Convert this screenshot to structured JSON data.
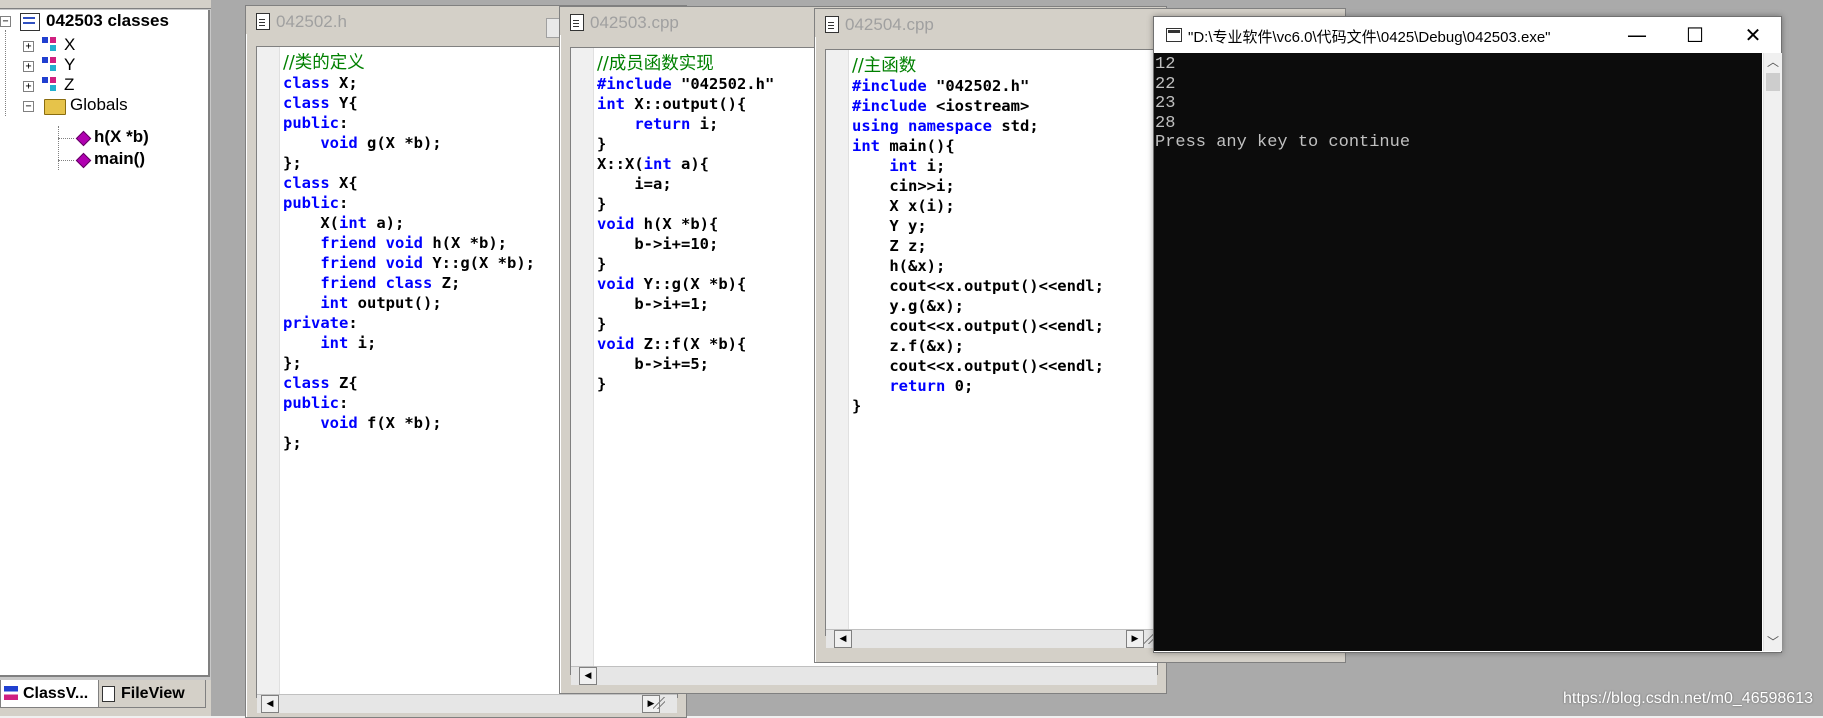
{
  "class_view": {
    "root_label": "042503 classes",
    "items": [
      {
        "label": "X",
        "type": "class"
      },
      {
        "label": "Y",
        "type": "class"
      },
      {
        "label": "Z",
        "type": "class"
      },
      {
        "label": "Globals",
        "type": "folder"
      }
    ],
    "globals_children": [
      "h(X *b)",
      "main()"
    ],
    "tabs": [
      {
        "label": "ClassV...",
        "active": true
      },
      {
        "label": "FileView",
        "active": false
      }
    ]
  },
  "windows": {
    "h": {
      "title": "042502.h",
      "lines": [
        [
          {
            "t": "//类的定义",
            "c": "cm"
          }
        ],
        [
          {
            "t": "class",
            "c": "kw"
          },
          {
            "t": " X;"
          }
        ],
        [
          {
            "t": "class",
            "c": "kw"
          },
          {
            "t": " Y{"
          }
        ],
        [
          {
            "t": "public",
            "c": "kw"
          },
          {
            "t": ":"
          }
        ],
        [
          {
            "t": "    "
          },
          {
            "t": "void",
            "c": "kw"
          },
          {
            "t": " g(X *b);"
          }
        ],
        [
          {
            "t": "};"
          }
        ],
        [
          {
            "t": "class",
            "c": "kw"
          },
          {
            "t": " X{"
          }
        ],
        [
          {
            "t": "public",
            "c": "kw"
          },
          {
            "t": ":"
          }
        ],
        [
          {
            "t": "    X("
          },
          {
            "t": "int",
            "c": "kw"
          },
          {
            "t": " a);"
          }
        ],
        [
          {
            "t": "    "
          },
          {
            "t": "friend",
            "c": "kw"
          },
          {
            "t": " "
          },
          {
            "t": "void",
            "c": "kw"
          },
          {
            "t": " h(X *b);"
          }
        ],
        [
          {
            "t": "    "
          },
          {
            "t": "friend",
            "c": "kw"
          },
          {
            "t": " "
          },
          {
            "t": "void",
            "c": "kw"
          },
          {
            "t": " Y::g(X *b);"
          }
        ],
        [
          {
            "t": "    "
          },
          {
            "t": "friend",
            "c": "kw"
          },
          {
            "t": " "
          },
          {
            "t": "class",
            "c": "kw"
          },
          {
            "t": " Z;"
          }
        ],
        [
          {
            "t": "    "
          },
          {
            "t": "int",
            "c": "kw"
          },
          {
            "t": " output();"
          }
        ],
        [
          {
            "t": "private",
            "c": "kw"
          },
          {
            "t": ":"
          }
        ],
        [
          {
            "t": "    "
          },
          {
            "t": "int",
            "c": "kw"
          },
          {
            "t": " i;"
          }
        ],
        [
          {
            "t": "};"
          }
        ],
        [
          {
            "t": "class",
            "c": "kw"
          },
          {
            "t": " Z{"
          }
        ],
        [
          {
            "t": "public",
            "c": "kw"
          },
          {
            "t": ":"
          }
        ],
        [
          {
            "t": "    "
          },
          {
            "t": "void",
            "c": "kw"
          },
          {
            "t": " f(X *b);"
          }
        ],
        [
          {
            "t": "};"
          }
        ]
      ]
    },
    "cpp3": {
      "title": "042503.cpp",
      "lines": [
        [
          {
            "t": "//成员函数实现",
            "c": "cm"
          }
        ],
        [
          {
            "t": "#include",
            "c": "kw"
          },
          {
            "t": " \"042502.h\""
          }
        ],
        [
          {
            "t": "int",
            "c": "kw"
          },
          {
            "t": " X::output(){"
          }
        ],
        [
          {
            "t": "    "
          },
          {
            "t": "return",
            "c": "kw"
          },
          {
            "t": " i;"
          }
        ],
        [
          {
            "t": "}"
          }
        ],
        [
          {
            "t": "X::X("
          },
          {
            "t": "int",
            "c": "kw"
          },
          {
            "t": " a){"
          }
        ],
        [
          {
            "t": "    i=a;"
          }
        ],
        [
          {
            "t": "}"
          }
        ],
        [
          {
            "t": "void",
            "c": "kw"
          },
          {
            "t": " h(X *b){"
          }
        ],
        [
          {
            "t": "    b->i+=10;"
          }
        ],
        [
          {
            "t": "}"
          }
        ],
        [
          {
            "t": "void",
            "c": "kw"
          },
          {
            "t": " Y::g(X *b){"
          }
        ],
        [
          {
            "t": "    b->i+=1;"
          }
        ],
        [
          {
            "t": "}"
          }
        ],
        [
          {
            "t": "void",
            "c": "kw"
          },
          {
            "t": " Z::f(X *b){"
          }
        ],
        [
          {
            "t": "    b->i+=5;"
          }
        ],
        [
          {
            "t": "}"
          }
        ]
      ]
    },
    "cpp4": {
      "title": "042504.cpp",
      "lines": [
        [
          {
            "t": "//主函数",
            "c": "cm"
          }
        ],
        [
          {
            "t": "#include",
            "c": "kw"
          },
          {
            "t": " \"042502.h\""
          }
        ],
        [
          {
            "t": "#include",
            "c": "kw"
          },
          {
            "t": " <iostream>"
          }
        ],
        [
          {
            "t": "using",
            "c": "kw"
          },
          {
            "t": " "
          },
          {
            "t": "namespace",
            "c": "kw"
          },
          {
            "t": " std;"
          }
        ],
        [
          {
            "t": "int",
            "c": "kw"
          },
          {
            "t": " main(){"
          }
        ],
        [
          {
            "t": "    "
          },
          {
            "t": "int",
            "c": "kw"
          },
          {
            "t": " i;"
          }
        ],
        [
          {
            "t": "    cin>>i;"
          }
        ],
        [
          {
            "t": "    X x(i);"
          }
        ],
        [
          {
            "t": "    Y y;"
          }
        ],
        [
          {
            "t": "    Z z;"
          }
        ],
        [
          {
            "t": "    h(&x);"
          }
        ],
        [
          {
            "t": "    cout<<x.output()<<endl;"
          }
        ],
        [
          {
            "t": "    y.g(&x);"
          }
        ],
        [
          {
            "t": "    cout<<x.output()<<endl;"
          }
        ],
        [
          {
            "t": "    z.f(&x);"
          }
        ],
        [
          {
            "t": "    cout<<x.output()<<endl;"
          }
        ],
        [
          {
            "t": "    "
          },
          {
            "t": "return",
            "c": "kw"
          },
          {
            "t": " 0;"
          }
        ],
        [
          {
            "t": "}"
          }
        ]
      ]
    }
  },
  "console": {
    "title": "\"D:\\专业软件\\vc6.0\\代码文件\\0425\\Debug\\042503.exe\"",
    "minimize": "—",
    "maximize": "☐",
    "close": "✕",
    "output": [
      "12",
      "22",
      "23",
      "28",
      "Press any key to continue"
    ]
  },
  "watermark": "https://blog.csdn.net/m0_46598613"
}
